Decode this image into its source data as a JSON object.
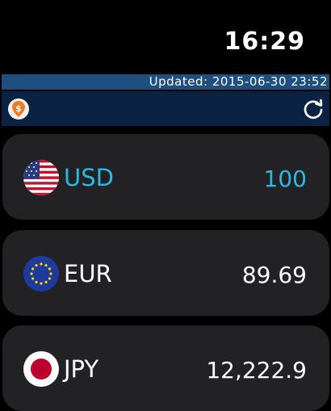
{
  "status": {
    "time": "16:29"
  },
  "header": {
    "updated_text": "Updated: 2015-06-30 23:52"
  },
  "icons": {
    "app": "dollar-pin-icon",
    "refresh": "refresh-icon"
  },
  "colors": {
    "accent": "#2bb8e6",
    "header_bar": "#1f4f7f",
    "toolbar": "#0b2342",
    "card": "#222224"
  },
  "currencies": [
    {
      "code": "USD",
      "value": "100",
      "flag": "us-flag-icon",
      "active": true
    },
    {
      "code": "EUR",
      "value": "89.69",
      "flag": "eu-flag-icon",
      "active": false
    },
    {
      "code": "JPY",
      "value": "12,222.9",
      "flag": "jp-flag-icon",
      "active": false
    }
  ]
}
